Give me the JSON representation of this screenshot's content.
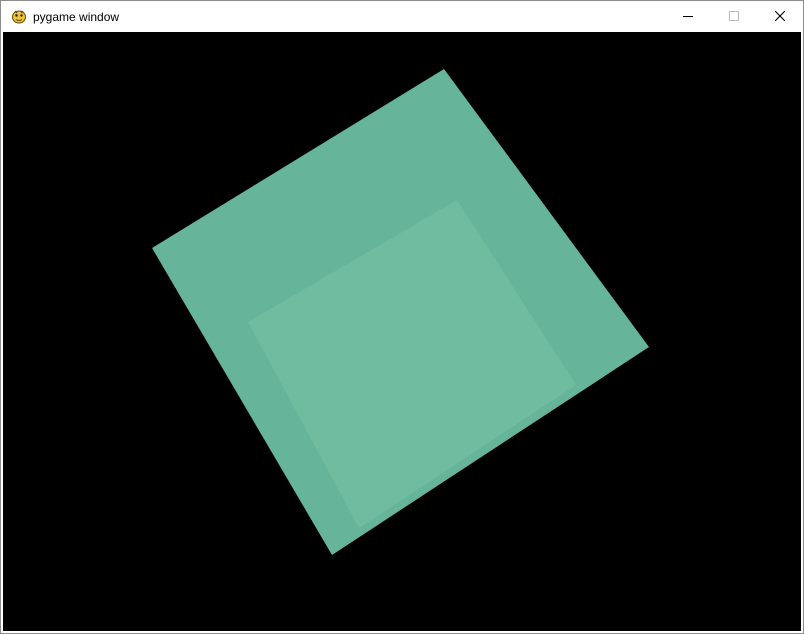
{
  "window": {
    "title": "pygame window"
  },
  "icons": {
    "app": "pygame-snake-icon",
    "minimize": "minimize-icon",
    "maximize": "maximize-icon",
    "close": "close-icon"
  },
  "colors": {
    "background": "#000000",
    "cube_outer": "#66b49a",
    "cube_inner": "#6fbca1"
  }
}
